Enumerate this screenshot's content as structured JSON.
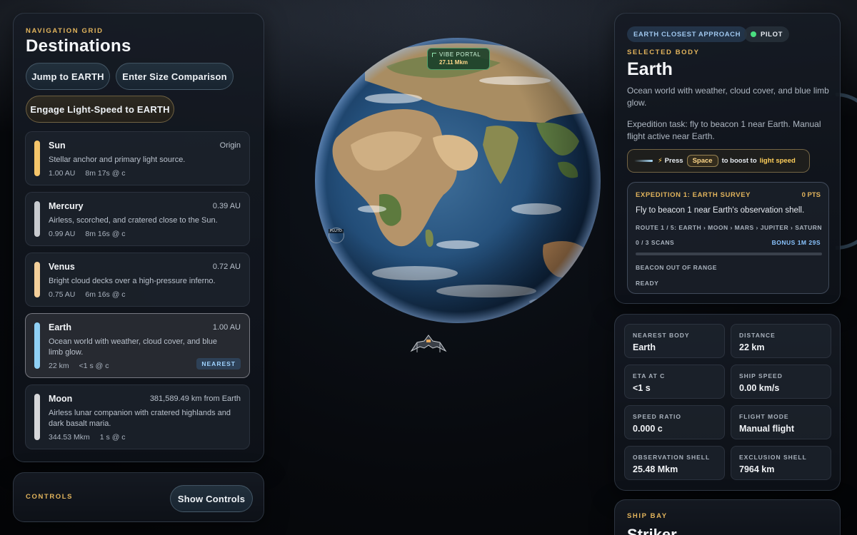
{
  "nav": {
    "kicker": "NAVIGATION GRID",
    "title": "Destinations",
    "buttons": {
      "jump": "Jump to EARTH",
      "size": "Enter Size Comparison",
      "light_speed": "Engage Light-Speed to EARTH"
    },
    "destinations": [
      {
        "name": "Sun",
        "meta": "Origin",
        "desc": "Stellar anchor and primary light source.",
        "dist": "1.00 AU",
        "light": "8m 17s @ c",
        "color": "#f5c56a"
      },
      {
        "name": "Mercury",
        "meta": "0.39 AU",
        "desc": "Airless, scorched, and cratered close to the Sun.",
        "dist": "0.99 AU",
        "light": "8m 16s @ c",
        "color": "#c8cbd0"
      },
      {
        "name": "Venus",
        "meta": "0.72 AU",
        "desc": "Bright cloud decks over a high-pressure inferno.",
        "dist": "0.75 AU",
        "light": "6m 16s @ c",
        "color": "#f3cf9a"
      },
      {
        "name": "Earth",
        "meta": "1.00 AU",
        "desc": "Ocean world with weather, cloud cover, and blue limb glow.",
        "dist": "22 km",
        "light": "<1 s @ c",
        "color": "#8fd0f5",
        "badge": "NEAREST"
      },
      {
        "name": "Moon",
        "meta": "381,589.49 km from Earth",
        "desc": "Airless lunar companion with cratered highlands and dark basalt maria.",
        "dist": "344.53 Mkm",
        "light": "1 s @ c",
        "color": "#d6d7da"
      }
    ]
  },
  "controls": {
    "kicker": "CONTROLS",
    "button": "Show Controls"
  },
  "viewport": {
    "portal_label": "VIBE PORTAL",
    "portal_distance": "27.11 Mkm",
    "marker_label": "PLUTO"
  },
  "info": {
    "chip_approach": "EARTH CLOSEST APPROACH",
    "chip_pilot": "PILOT",
    "kicker": "SELECTED BODY",
    "title": "Earth",
    "desc": "Ocean world with weather, cloud cover, and blue limb glow.",
    "task": "Expedition task: fly to beacon 1 near Earth. Manual flight active near Earth.",
    "boost": {
      "press": "Press",
      "key": "Space",
      "to_boost": "to boost to",
      "light_speed": "light speed"
    },
    "expedition": {
      "title": "EXPEDITION 1: EARTH SURVEY",
      "points": "0 PTS",
      "objective": "Fly to beacon 1 near Earth's observation shell.",
      "route": "ROUTE 1 / 5: EARTH › MOON › MARS › JUPITER › SATURN",
      "scans": "0 / 3 SCANS",
      "bonus": "BONUS 1M 29S",
      "progress": 0,
      "beacon": "BEACON OUT OF RANGE",
      "status": "READY"
    }
  },
  "stats": [
    {
      "label": "NEAREST BODY",
      "value": "Earth"
    },
    {
      "label": "DISTANCE",
      "value": "22 km"
    },
    {
      "label": "ETA AT C",
      "value": "<1 s"
    },
    {
      "label": "SHIP SPEED",
      "value": "0.00 km/s"
    },
    {
      "label": "SPEED RATIO",
      "value": "0.000 c"
    },
    {
      "label": "FLIGHT MODE",
      "value": "Manual flight"
    },
    {
      "label": "OBSERVATION SHELL",
      "value": "25.48 Mkm"
    },
    {
      "label": "EXCLUSION SHELL",
      "value": "7964 km"
    }
  ],
  "ship_bay": {
    "kicker": "SHIP BAY",
    "title": "Striker"
  },
  "colors": {
    "accent": "#e2b45c",
    "pilot_dot": "#4ade80",
    "info_blue": "#8ac4ff"
  }
}
